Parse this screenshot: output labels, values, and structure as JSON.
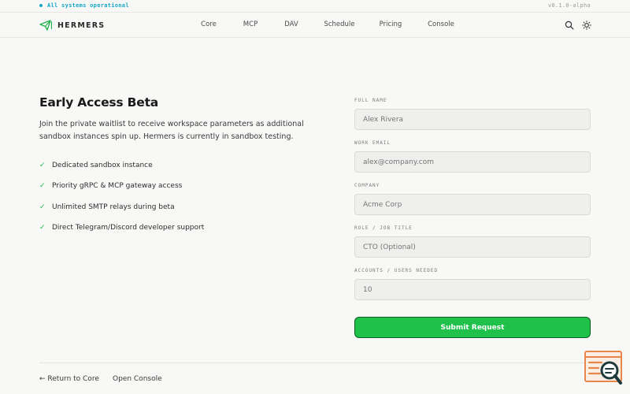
{
  "status": {
    "message": "All systems operational",
    "version": "v0.1.0-alpha"
  },
  "brand": {
    "name": "HERMERS"
  },
  "nav": {
    "items": [
      "Core",
      "MCP",
      "DAV",
      "Schedule",
      "Pricing",
      "Console"
    ]
  },
  "header_icons": [
    "search-icon",
    "sun-icon"
  ],
  "hero": {
    "title": "Early Access Beta",
    "description": "Join the private waitlist to receive workspace parameters as additional sandbox instances spin up. Hermers is currently in sandbox testing.",
    "benefits": [
      "Dedicated sandbox instance",
      "Priority gRPC & MCP gateway access",
      "Unlimited SMTP relays during beta",
      "Direct Telegram/Discord developer support"
    ],
    "check_glyph": "✓"
  },
  "form": {
    "fields": [
      {
        "label": "FULL NAME",
        "placeholder": "Alex Rivera"
      },
      {
        "label": "WORK EMAIL",
        "placeholder": "alex@company.com"
      },
      {
        "label": "COMPANY",
        "placeholder": "Acme Corp"
      },
      {
        "label": "ROLE / JOB TITLE",
        "placeholder": "CTO (Optional)"
      },
      {
        "label": "ACCOUNTS / USERS NEEDED",
        "placeholder": "10"
      }
    ],
    "submit_label": "Submit Request"
  },
  "footer": {
    "back_label": "← Return to Core",
    "console_label": "Open Console"
  },
  "colors": {
    "accent_cyan": "#14a7c7",
    "submit_green": "#1fc14a",
    "submit_border": "#0b5f24",
    "check_green": "#1fb24a",
    "badge_orange": "#e9874a"
  }
}
